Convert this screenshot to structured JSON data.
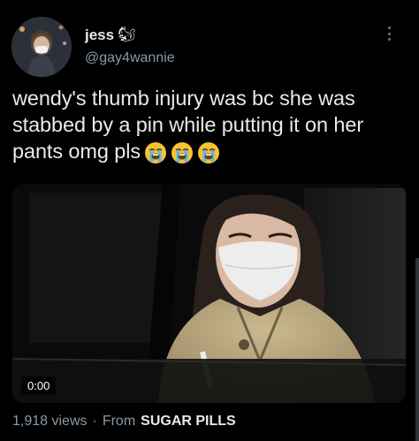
{
  "author": {
    "display_name": "jess",
    "name_emoji": "🐿",
    "handle": "@gay4wannie"
  },
  "tweet": {
    "text": "wendy's thumb injury was bc she was stabbed by a pin while putting it on her pants omg pls",
    "emojis": [
      "loudly-crying-face",
      "loudly-crying-face",
      "loudly-crying-face"
    ]
  },
  "media": {
    "type": "video",
    "timestamp": "0:00"
  },
  "footer": {
    "views": "1,918 views",
    "separator": "·",
    "from_label": "From",
    "source": "SUGAR PILLS"
  },
  "colors": {
    "background": "#000000",
    "text": "#e7e9ea",
    "secondary_text": "#8b98a5",
    "emoji_yellow": "#f7c234"
  }
}
